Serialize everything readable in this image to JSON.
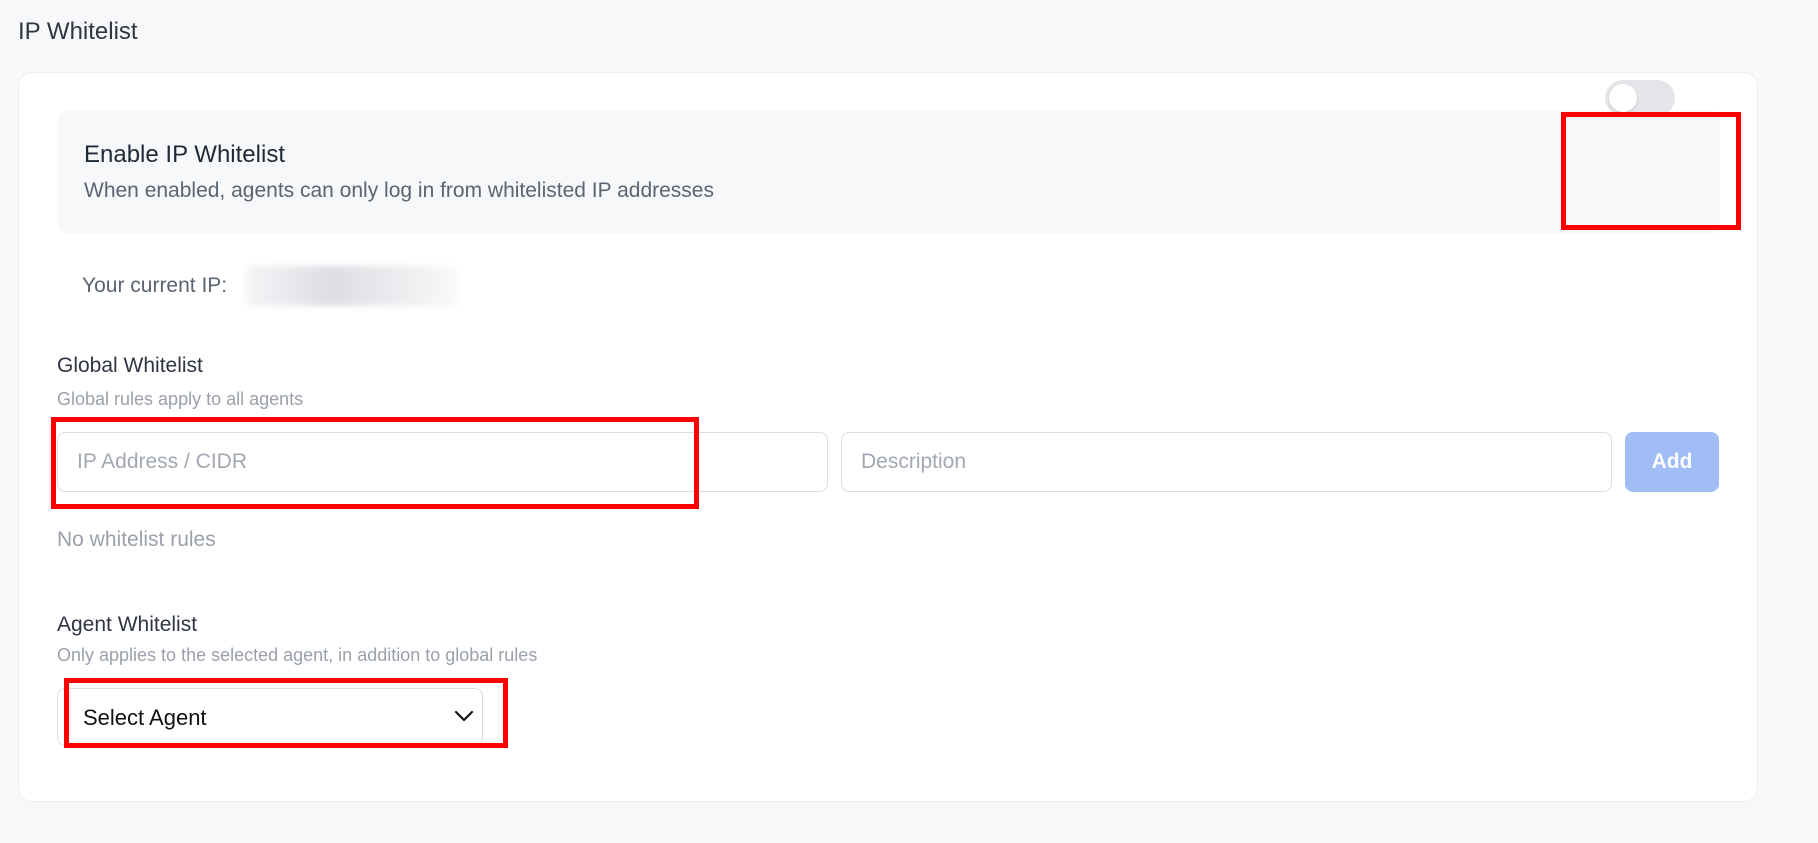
{
  "page": {
    "title": "IP Whitelist"
  },
  "enable": {
    "title": "Enable IP Whitelist",
    "description": "When enabled, agents can only log in from whitelisted IP addresses",
    "enabled": false
  },
  "current_ip": {
    "label": "Your current IP:"
  },
  "global": {
    "title": "Global Whitelist",
    "description": "Global rules apply to all agents",
    "ip_placeholder": "IP Address / CIDR",
    "description_placeholder": "Description",
    "add_label": "Add",
    "empty_text": "No whitelist rules"
  },
  "agent": {
    "title": "Agent Whitelist",
    "description": "Only applies to the selected agent, in addition to global rules",
    "select_label": "Select Agent"
  },
  "icons": {
    "select_chevron": "chevron-down-icon"
  },
  "colors": {
    "highlight": "#ff0000",
    "add_button": "#a0bdf5",
    "toggle_off": "#e3e5e9"
  }
}
